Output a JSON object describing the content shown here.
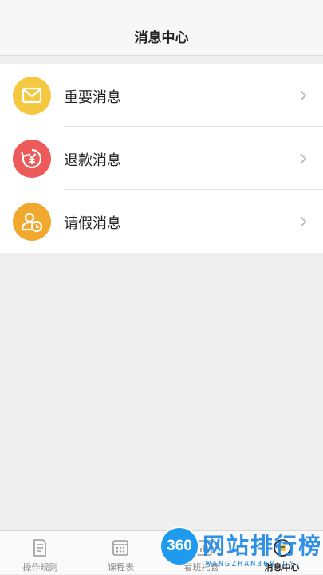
{
  "header": {
    "title": "消息中心"
  },
  "messages": [
    {
      "label": "重要消息",
      "icon": "mail-icon",
      "color": "#f5c842"
    },
    {
      "label": "退款消息",
      "icon": "refund-yen-icon",
      "color": "#ec5a5a"
    },
    {
      "label": "请假消息",
      "icon": "leave-user-clock-icon",
      "color": "#f0a92e"
    }
  ],
  "tabbar": {
    "tabs": [
      {
        "label": "操作规则",
        "icon": "document-icon",
        "active": false
      },
      {
        "label": "课程表",
        "icon": "calendar-grid-icon",
        "active": false
      },
      {
        "label": "看班托管",
        "icon": "chart-icon",
        "active": false
      },
      {
        "label": "消息中心",
        "icon": "message-icon",
        "active": true
      }
    ]
  },
  "watermark": {
    "badge": "360",
    "text": "网站排行榜",
    "sub": "WANGZHAN360.CN-"
  }
}
